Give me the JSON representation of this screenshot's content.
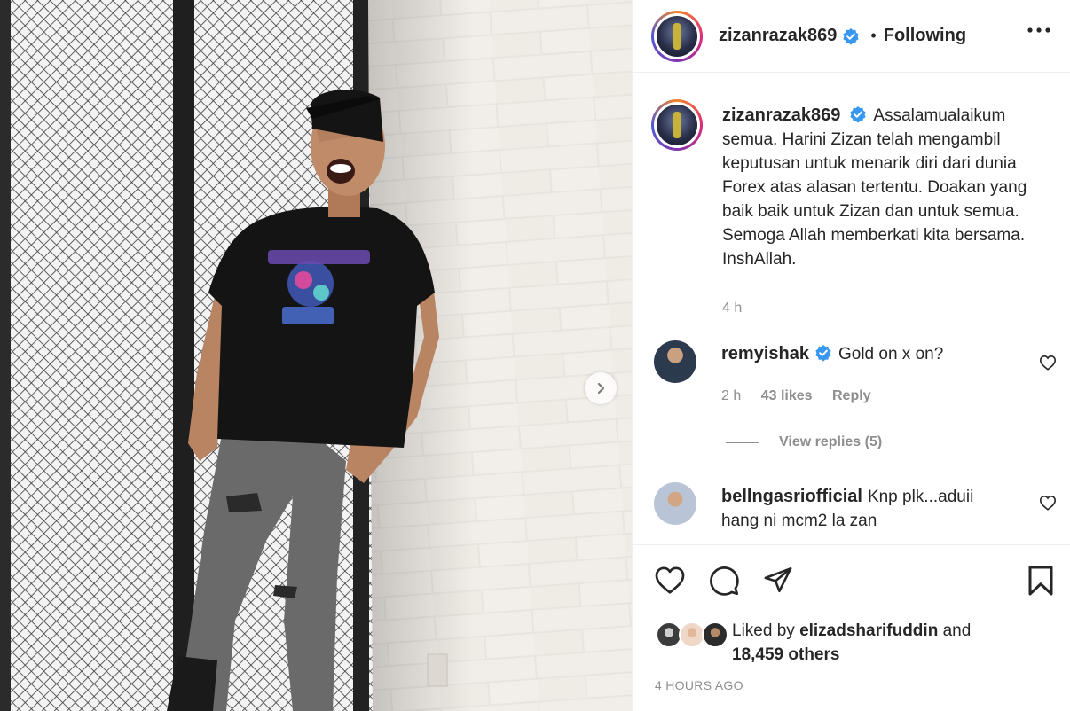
{
  "post": {
    "author": "zizanrazak869",
    "follow_status": "Following",
    "separator": "•",
    "caption": "Assalamualaikum semua. Harini Zizan telah mengambil keputusan untuk menarik diri dari dunia Forex atas alasan tertentu. Doakan yang baik baik untuk Zizan dan untuk semua. Semoga Allah memberkati kita bersama. InshAllah.",
    "caption_time": "4 h"
  },
  "comments": [
    {
      "username": "remyishak",
      "verified": true,
      "text": "Gold on x on?",
      "time": "2 h",
      "likes": "43 likes",
      "reply_label": "Reply",
      "view_replies": "View replies (5)"
    },
    {
      "username": "bellngasriofficial",
      "verified": false,
      "text": "Knp plk...aduii hang ni mcm2 la zan"
    }
  ],
  "engagement": {
    "liked_by_prefix": "Liked by",
    "liked_by_user": "elizadsharifuddin",
    "and": "and",
    "others": "18,459 others",
    "timestamp": "4 HOURS AGO"
  },
  "icons": {
    "more": "more-options-icon",
    "like": "heart-icon",
    "comment": "comment-icon",
    "share": "share-icon",
    "save": "bookmark-icon",
    "next": "chevron-right-icon",
    "verified": "verified-badge-icon"
  },
  "colors": {
    "verified": "#3897f0",
    "secondary_text": "#8e8e8e",
    "primary_text": "#262626"
  }
}
